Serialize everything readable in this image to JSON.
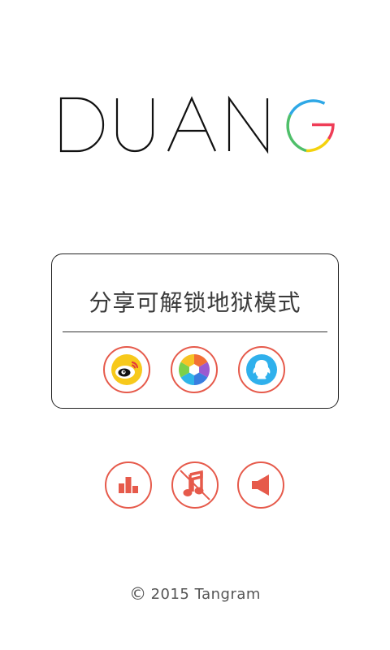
{
  "logo": {
    "text": "DUANG"
  },
  "share": {
    "title": "分享可解锁地狱模式",
    "buttons": [
      {
        "name": "weibo-share",
        "icon": "weibo-icon"
      },
      {
        "name": "moments-share",
        "icon": "aperture-icon"
      },
      {
        "name": "qq-share",
        "icon": "qq-penguin-icon"
      }
    ]
  },
  "controls": [
    {
      "name": "leaderboard",
      "icon": "bar-chart-icon"
    },
    {
      "name": "music-toggle",
      "icon": "music-note-muted-icon",
      "state": "off"
    },
    {
      "name": "sound-toggle",
      "icon": "speaker-icon",
      "state": "on"
    }
  ],
  "footer": {
    "symbol": "©",
    "text": "2015 Tangram"
  },
  "colors": {
    "accent": "#e65a4b",
    "weibo_yellow": "#f7c91b",
    "qq_blue": "#2fb0ec",
    "logo_g": [
      "#2fa8e6",
      "#f4d20d",
      "#ef3d57",
      "#4fbf6a"
    ]
  }
}
